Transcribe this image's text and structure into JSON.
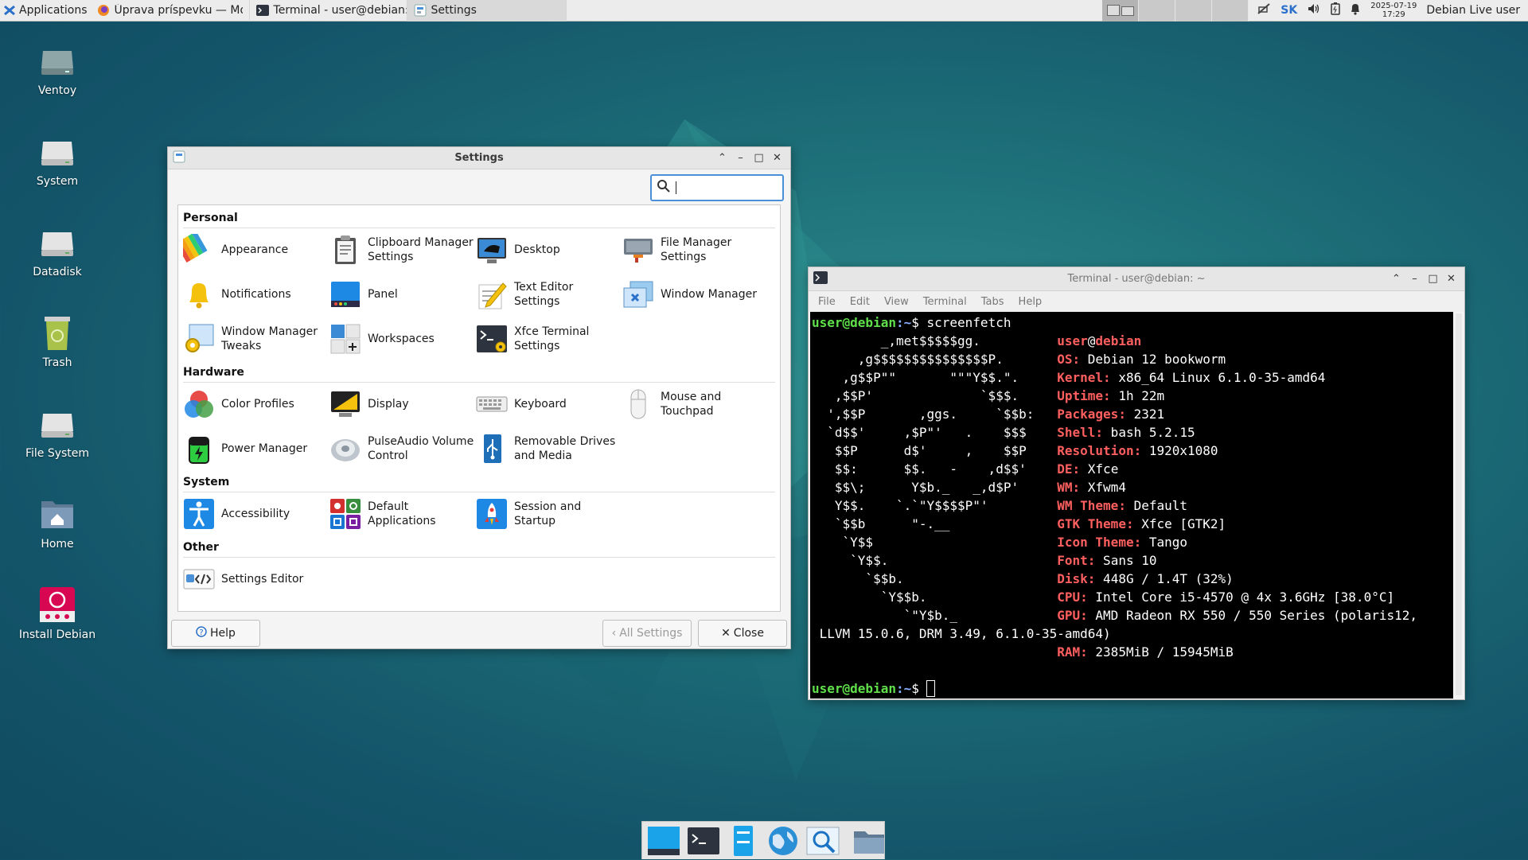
{
  "top_panel": {
    "apps_label": "Applications",
    "tasks": [
      {
        "label": "Úprava príspevku — Mozil..."
      },
      {
        "label": "Terminal - user@debian: ~"
      },
      {
        "label": "Settings"
      }
    ],
    "keyboard_layout": "SK",
    "clock_date": "2025-07-19",
    "clock_time": "17:29",
    "user": "Debian Live user"
  },
  "desktop": {
    "icons": [
      {
        "label": "Ventoy"
      },
      {
        "label": "System"
      },
      {
        "label": "Datadisk"
      },
      {
        "label": "Trash"
      },
      {
        "label": "File System"
      },
      {
        "label": "Home"
      },
      {
        "label": "Install Debian"
      }
    ]
  },
  "settings": {
    "title": "Settings",
    "search_value": "",
    "categories": [
      {
        "title": "Personal",
        "items": [
          {
            "label": "Appearance",
            "icon": "appearance-icon"
          },
          {
            "label": "Clipboard Manager Settings",
            "icon": "clipboard-icon"
          },
          {
            "label": "Desktop",
            "icon": "desktop-icon"
          },
          {
            "label": "File Manager Settings",
            "icon": "file-manager-icon"
          },
          {
            "label": "Notifications",
            "icon": "bell-icon"
          },
          {
            "label": "Panel",
            "icon": "panel-icon"
          },
          {
            "label": "Text Editor Settings",
            "icon": "text-editor-icon"
          },
          {
            "label": "Window Manager",
            "icon": "window-manager-icon"
          },
          {
            "label": "Window Manager Tweaks",
            "icon": "wm-tweaks-icon"
          },
          {
            "label": "Workspaces",
            "icon": "workspaces-icon"
          },
          {
            "label": "Xfce Terminal Settings",
            "icon": "terminal-settings-icon"
          }
        ]
      },
      {
        "title": "Hardware",
        "items": [
          {
            "label": "Color Profiles",
            "icon": "color-profiles-icon"
          },
          {
            "label": "Display",
            "icon": "display-icon"
          },
          {
            "label": "Keyboard",
            "icon": "keyboard-icon"
          },
          {
            "label": "Mouse and Touchpad",
            "icon": "mouse-icon"
          },
          {
            "label": "Power Manager",
            "icon": "battery-icon"
          },
          {
            "label": "PulseAudio Volume Control",
            "icon": "speaker-icon"
          },
          {
            "label": "Removable Drives and Media",
            "icon": "usb-icon"
          }
        ]
      },
      {
        "title": "System",
        "items": [
          {
            "label": "Accessibility",
            "icon": "accessibility-icon"
          },
          {
            "label": "Default Applications",
            "icon": "default-apps-icon"
          },
          {
            "label": "Session and Startup",
            "icon": "rocket-icon"
          }
        ]
      },
      {
        "title": "Other",
        "items": [
          {
            "label": "Settings Editor",
            "icon": "settings-editor-icon"
          }
        ]
      }
    ],
    "help_label": "Help",
    "all_settings_label": "All Settings",
    "close_label": "Close"
  },
  "terminal": {
    "title": "Terminal - user@debian: ~",
    "menu": [
      "File",
      "Edit",
      "View",
      "Terminal",
      "Tabs",
      "Help"
    ],
    "prompt_user": "user@debian",
    "prompt_path": ":~",
    "prompt_symbol": "$ ",
    "command": "screenfetch",
    "logo_lines": [
      "         _,met$$$$$gg.",
      "      ,g$$$$$$$$$$$$$$$P.",
      "    ,g$$P\"\"       \"\"\"Y$$.\".",
      "   ,$$P'              `$$$.",
      "  ',$$P       ,ggs.     `$$b:",
      "  `d$$'     ,$P\"'   .    $$$",
      "   $$P      d$'     ,    $$P",
      "   $$:      $$.   -    ,d$$'",
      "   $$\\;      Y$b._   _,d$P'",
      "   Y$$.    `.`\"Y$$$$P\"'",
      "   `$$b      \"-.__",
      "    `Y$$",
      "     `Y$$.",
      "       `$$b.",
      "         `Y$$b.",
      "            `\"Y$b._",
      "                `\"\"\"\""
    ],
    "info_user": "user",
    "info_at": "@",
    "info_host": "debian",
    "info": [
      {
        "key": "OS:",
        "value": " Debian 12 bookworm"
      },
      {
        "key": "Kernel:",
        "value": " x86_64 Linux 6.1.0-35-amd64"
      },
      {
        "key": "Uptime:",
        "value": " 1h 22m"
      },
      {
        "key": "Packages:",
        "value": " 2321"
      },
      {
        "key": "Shell:",
        "value": " bash 5.2.15"
      },
      {
        "key": "Resolution:",
        "value": " 1920x1080"
      },
      {
        "key": "DE:",
        "value": " Xfce"
      },
      {
        "key": "WM:",
        "value": " Xfwm4"
      },
      {
        "key": "WM Theme:",
        "value": " Default"
      },
      {
        "key": "GTK Theme:",
        "value": " Xfce [GTK2]"
      },
      {
        "key": "Icon Theme:",
        "value": " Tango"
      },
      {
        "key": "Font:",
        "value": " Sans 10"
      },
      {
        "key": "Disk:",
        "value": " 448G / 1.4T (32%)"
      },
      {
        "key": "CPU:",
        "value": " Intel Core i5-4570 @ 4x 3.6GHz [38.0°C]"
      },
      {
        "key": "GPU:",
        "value": " AMD Radeon RX 550 / 550 Series (polaris12,"
      },
      {
        "key": "",
        "value": " LLVM 15.0.6, DRM 3.49, 6.1.0-35-amd64)"
      },
      {
        "key": "RAM:",
        "value": " 2385MiB / 15945MiB"
      }
    ]
  },
  "dock": {
    "items": [
      {
        "icon": "show-desktop-icon"
      },
      {
        "icon": "terminal-icon"
      },
      {
        "icon": "file-manager-icon"
      },
      {
        "icon": "web-browser-icon"
      },
      {
        "icon": "app-finder-icon"
      },
      {
        "icon": "folder-icon"
      }
    ]
  }
}
